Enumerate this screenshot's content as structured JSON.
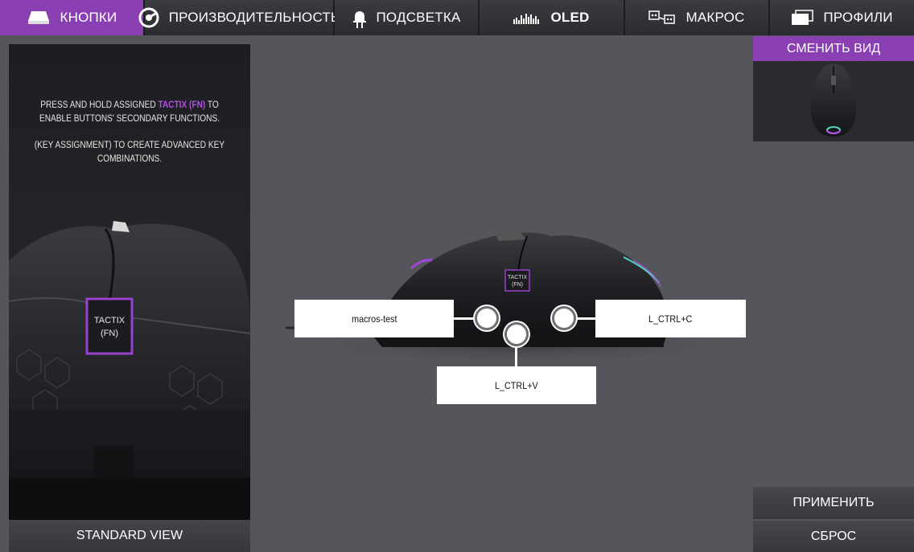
{
  "tabs": [
    {
      "label": "КНОПКИ",
      "icon": "keycap-icon",
      "active": true
    },
    {
      "label": "ПРОИЗВОДИТЕЛЬНОСТЬ",
      "icon": "gauge-icon",
      "active": false
    },
    {
      "label": "ПОДСВЕТКА",
      "icon": "led-icon",
      "active": false
    },
    {
      "label": "OLED",
      "icon": "oled-bars-icon",
      "active": false
    },
    {
      "label": "МАКРОС",
      "icon": "macro-keys-icon",
      "active": false
    },
    {
      "label": "ПРОФИЛИ",
      "icon": "profiles-icon",
      "active": false
    }
  ],
  "info": {
    "line1_pre": "PRESS AND HOLD ASSIGNED ",
    "line1_highlight": "TACTIX (FN)",
    "line1_post": " TO",
    "line2": "ENABLE BUTTONS' SECONDARY FUNCTIONS.",
    "line3": "(KEY ASSIGNMENT) TO CREATE ADVANCED KEY COMBINATIONS."
  },
  "left_mouse": {
    "tactix_line1": "TACTIX",
    "tactix_line2": "(FN)"
  },
  "center_mouse": {
    "tactix_line1": "TACTIX",
    "tactix_line2": "(FN)"
  },
  "standard_view_label": "STANDARD VIEW",
  "assignments": {
    "left": "macros-test",
    "right": "L_CTRL+C",
    "bottom": "L_CTRL+V"
  },
  "switch_view_label": "СМЕНИТЬ ВИД",
  "apply_label": "ПРИМЕНИТЬ",
  "reset_label": "СБРОС",
  "colors": {
    "accent": "#8a3fb3",
    "highlight": "#b44ee8",
    "background": "#55565b"
  }
}
